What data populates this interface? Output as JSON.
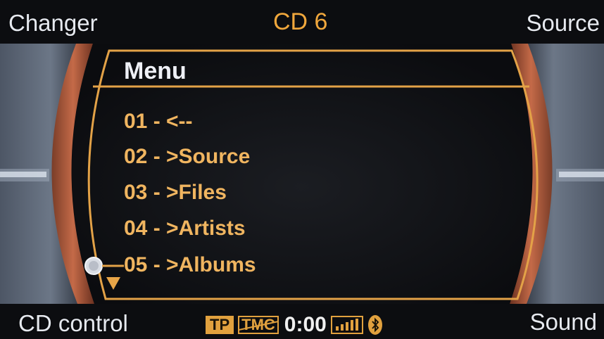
{
  "header": {
    "left_label": "Changer",
    "center_title": "CD 6",
    "right_label": "Source"
  },
  "menu": {
    "title": "Menu",
    "items": [
      {
        "label": "01 - <--"
      },
      {
        "label": "02 - >Source"
      },
      {
        "label": "03 - >Files"
      },
      {
        "label": "04 - >Artists"
      },
      {
        "label": "05 - >Albums"
      }
    ],
    "selected_index": 4
  },
  "footer": {
    "left_label": "CD control",
    "right_label": "Sound",
    "status": {
      "tp": "TP",
      "tmc": "TMC",
      "time": "0:00",
      "signal_icon": "signal-strength-icon",
      "bluetooth_icon": "bluetooth-icon"
    }
  },
  "colors": {
    "accent": "#f0a73c",
    "menu_text": "#f0b560",
    "label_text": "#e6e9ef",
    "background": "#0e0f12"
  }
}
